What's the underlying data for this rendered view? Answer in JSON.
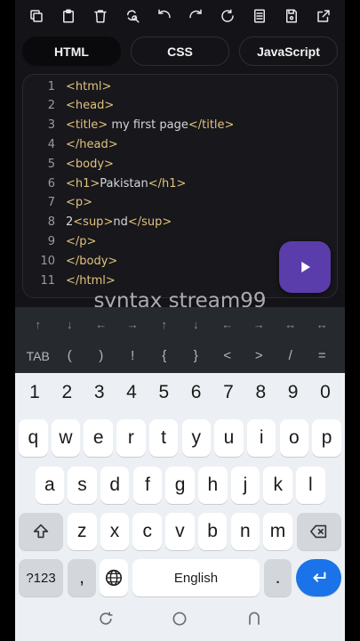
{
  "toolbar": {
    "icons": [
      "copy-icon",
      "paste-icon",
      "delete-icon",
      "find-replace-icon",
      "undo-icon",
      "redo-icon",
      "refresh-icon",
      "file-icon",
      "save-icon",
      "open-external-icon"
    ]
  },
  "tabs": [
    {
      "label": "HTML",
      "active": true
    },
    {
      "label": "CSS",
      "active": false
    },
    {
      "label": "JavaScript",
      "active": false
    }
  ],
  "editor": {
    "lines": [
      {
        "n": "1",
        "parts": [
          {
            "t": "tag",
            "v": "<html>"
          }
        ]
      },
      {
        "n": "2",
        "parts": [
          {
            "t": "tag",
            "v": "<head>"
          }
        ]
      },
      {
        "n": "3",
        "parts": [
          {
            "t": "tag",
            "v": "<title>"
          },
          {
            "t": "txt",
            "v": " my first page"
          },
          {
            "t": "tag",
            "v": "</title>"
          }
        ]
      },
      {
        "n": "4",
        "parts": [
          {
            "t": "tag",
            "v": "</head>"
          }
        ]
      },
      {
        "n": "5",
        "parts": [
          {
            "t": "tag",
            "v": "<body>"
          }
        ]
      },
      {
        "n": "6",
        "parts": [
          {
            "t": "tag",
            "v": "<h1>"
          },
          {
            "t": "txt",
            "v": "Pakistan"
          },
          {
            "t": "tag",
            "v": "</h1>"
          }
        ]
      },
      {
        "n": "7",
        "parts": [
          {
            "t": "tag",
            "v": "<p>"
          }
        ]
      },
      {
        "n": "8",
        "parts": [
          {
            "t": "txt",
            "v": "2"
          },
          {
            "t": "tag",
            "v": "<sup>"
          },
          {
            "t": "txt",
            "v": "nd"
          },
          {
            "t": "tag",
            "v": "</sup>"
          }
        ]
      },
      {
        "n": "9",
        "parts": [
          {
            "t": "tag",
            "v": "</p>"
          }
        ]
      },
      {
        "n": "10",
        "parts": [
          {
            "t": "tag",
            "v": "</body>"
          }
        ]
      },
      {
        "n": "11",
        "parts": [
          {
            "t": "tag",
            "v": "</html>"
          }
        ]
      }
    ]
  },
  "watermark": "syntax stream99",
  "extra_keys": {
    "arrows": [
      "↑",
      "↓",
      "←",
      "→",
      "↑",
      "↓",
      "←",
      "→",
      "↔",
      "↔"
    ],
    "symbols": [
      "TAB",
      "(",
      ")",
      "!",
      "{",
      "}",
      "<",
      ">",
      "/",
      "="
    ]
  },
  "keyboard": {
    "numbers": [
      "1",
      "2",
      "3",
      "4",
      "5",
      "6",
      "7",
      "8",
      "9",
      "0"
    ],
    "row1": [
      "q",
      "w",
      "e",
      "r",
      "t",
      "y",
      "u",
      "i",
      "o",
      "p"
    ],
    "row2": [
      "a",
      "s",
      "d",
      "f",
      "g",
      "h",
      "j",
      "k",
      "l"
    ],
    "row3": [
      "z",
      "x",
      "c",
      "v",
      "b",
      "n",
      "m"
    ],
    "symbols_key": "?123",
    "comma": ",",
    "space_label": "English",
    "period": "."
  },
  "colors": {
    "accent": "#5b3cab",
    "tag": "#e2c27c",
    "enter": "#1a73e8"
  }
}
